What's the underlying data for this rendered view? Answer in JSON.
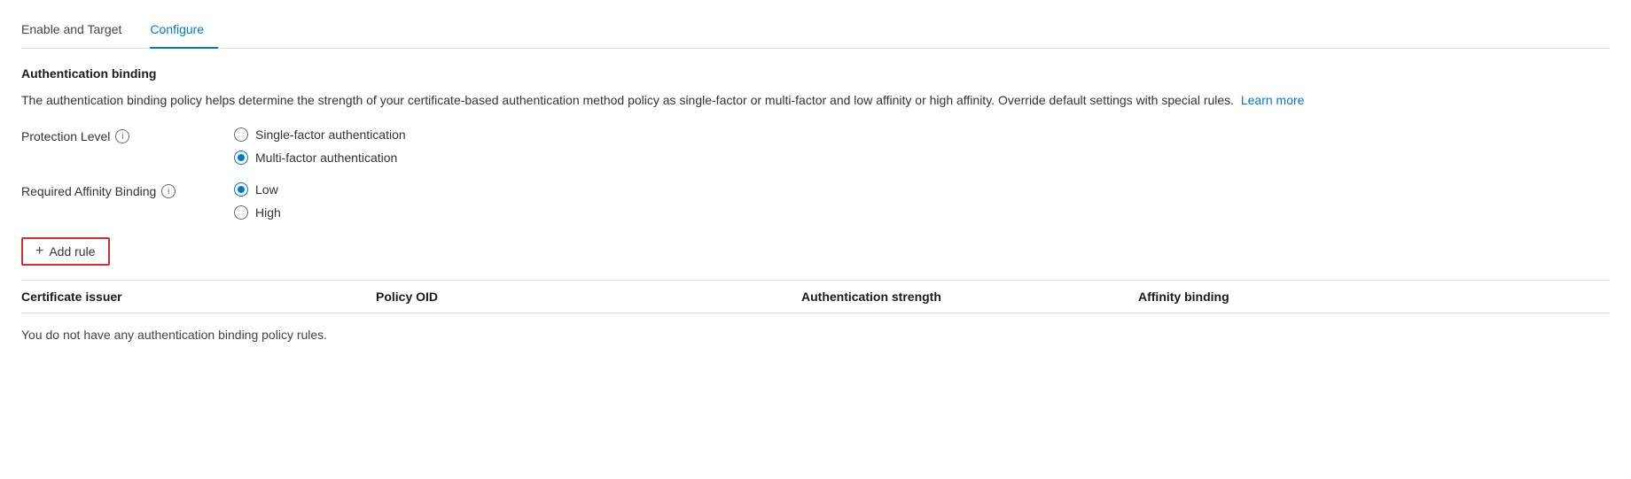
{
  "tabs": [
    {
      "id": "enable-target",
      "label": "Enable and Target",
      "active": false
    },
    {
      "id": "configure",
      "label": "Configure",
      "active": true
    }
  ],
  "section": {
    "title": "Authentication binding",
    "description": "The authentication binding policy helps determine the strength of your certificate-based authentication method policy as single-factor or multi-factor and low affinity or high affinity. Override default settings with special rules.",
    "learn_more_label": "Learn more"
  },
  "protection_level": {
    "label": "Protection Level",
    "options": [
      {
        "id": "single-factor",
        "label": "Single-factor authentication",
        "checked": false
      },
      {
        "id": "multi-factor",
        "label": "Multi-factor authentication",
        "checked": true
      }
    ]
  },
  "affinity_binding": {
    "label": "Required Affinity Binding",
    "options": [
      {
        "id": "low",
        "label": "Low",
        "checked": true
      },
      {
        "id": "high",
        "label": "High",
        "checked": false
      }
    ]
  },
  "add_rule_button": {
    "label": "Add rule",
    "icon": "+"
  },
  "table": {
    "columns": [
      {
        "id": "certificate-issuer",
        "label": "Certificate issuer"
      },
      {
        "id": "policy-oid",
        "label": "Policy OID"
      },
      {
        "id": "auth-strength",
        "label": "Authentication strength"
      },
      {
        "id": "affinity-binding",
        "label": "Affinity binding"
      }
    ],
    "empty_message": "You do not have any authentication binding policy rules."
  }
}
